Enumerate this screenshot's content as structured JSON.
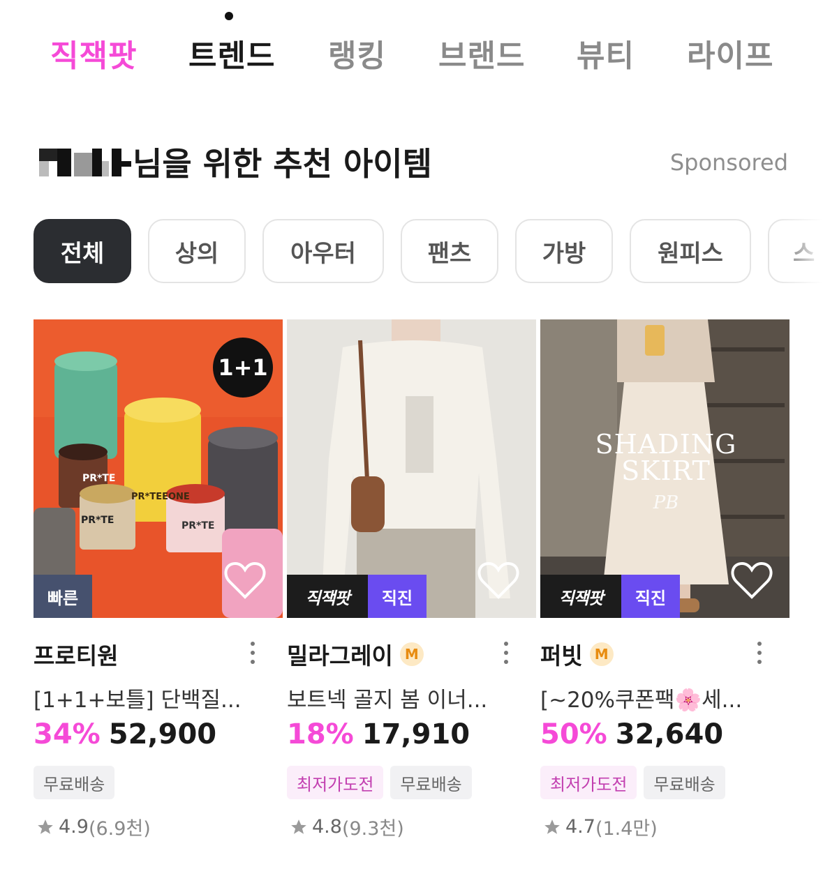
{
  "nav": {
    "tabs": [
      "직잭팟",
      "트렌드",
      "랭킹",
      "브랜드",
      "뷰티",
      "라이프"
    ]
  },
  "section": {
    "title": "님을 위한 추천 아이템",
    "sponsored": "Sponsored"
  },
  "chips": [
    "전체",
    "상의",
    "아우터",
    "팬츠",
    "가방",
    "원피스",
    "스"
  ],
  "colors": {
    "accent_pink": "#f54ad7",
    "chip_active": "#2b2d31",
    "brand_purple": "#6a4cf0"
  },
  "products": [
    {
      "badge": "1+1",
      "tag": "빠른",
      "brand": "프로티원",
      "name": "[1+1+보틀] 단백질...",
      "discount": "34%",
      "price": "52,900",
      "pills": [
        "무료배송"
      ],
      "rating": "4.9",
      "reviews": "(6.9천)"
    },
    {
      "tag_brand": "직잭팟",
      "tag_label": "직진",
      "brand": "밀라그레이",
      "member_badge": "M",
      "name": "보트넥 골지 봄 이너...",
      "discount": "18%",
      "price": "17,910",
      "pills": [
        "최저가도전",
        "무료배송"
      ],
      "rating": "4.8",
      "reviews": "(9.3천)"
    },
    {
      "overlay_title": "SHADING SKIRT",
      "overlay_logo": "PB",
      "tag_brand": "직잭팟",
      "tag_label": "직진",
      "brand": "퍼빗",
      "member_badge": "M",
      "name": "[~20%쿠폰팩🌸세...",
      "discount": "50%",
      "price": "32,640",
      "pills": [
        "최저가도전",
        "무료배송"
      ],
      "rating": "4.7",
      "reviews": "(1.4만)"
    }
  ]
}
